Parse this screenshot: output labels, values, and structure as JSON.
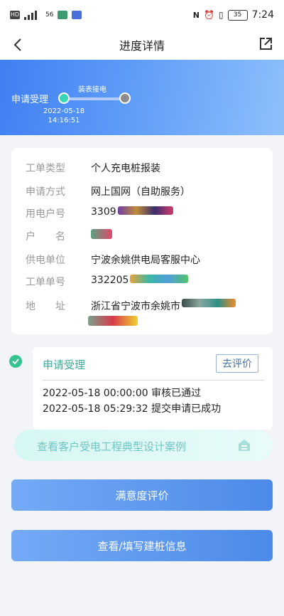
{
  "status_bar": {
    "network": "56",
    "battery": "35",
    "time": "7:24"
  },
  "nav": {
    "title": "进度详情"
  },
  "progress": {
    "current_step": "申请受理",
    "node_label": "装表接电",
    "date": "2022-05-18",
    "time": "14:16:51"
  },
  "details": {
    "rows": [
      {
        "label": "工单类型",
        "value": "个人充电桩报装"
      },
      {
        "label": "申请方式",
        "value": "网上国网（自助服务）"
      },
      {
        "label": "用电户号",
        "value": "3309"
      },
      {
        "label": "户　　名",
        "value": ""
      },
      {
        "label": "供电单位",
        "value": "宁波余姚供电局客服中心"
      },
      {
        "label": "工单单号",
        "value": "332205"
      },
      {
        "label": "地　　址",
        "value": "浙江省宁波市余姚市"
      }
    ]
  },
  "flow": {
    "title": "申请受理",
    "evaluate_button": "去评价",
    "items": [
      "2022-05-18 00:00:00 审核已通过",
      "2022-05-18 05:29:32 提交申请已成功"
    ]
  },
  "case_banner": {
    "text": "查看客户受电工程典型设计案例"
  },
  "buttons": {
    "satisfaction": "满意度评价",
    "pile_info": "查看/填写建桩信息"
  },
  "colors": {
    "accent_blue": "#4c8ae9",
    "accent_green": "#35c28f",
    "teal_text": "#3ba99c"
  }
}
